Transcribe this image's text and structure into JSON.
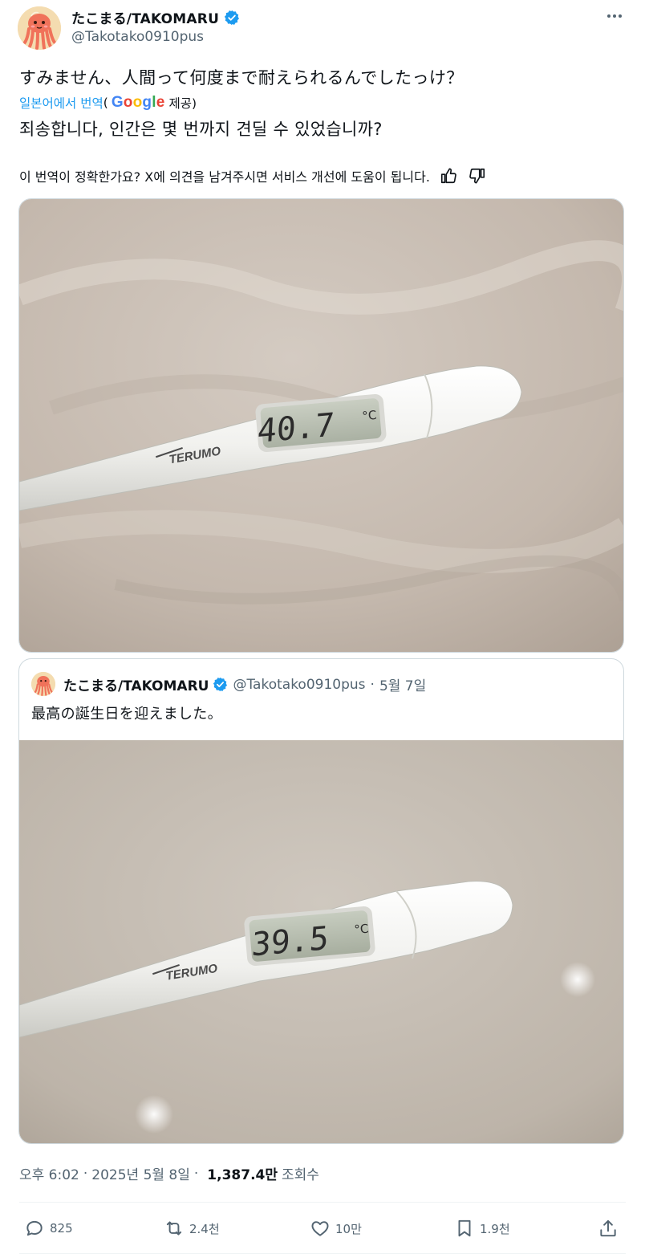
{
  "author": {
    "display_name": "たこまる/TAKOMARU",
    "handle": "@Takotako0910pus",
    "verified": true,
    "avatar_icon": "octopus-avatar-icon"
  },
  "post": {
    "original_text": "すみません、人間って何度まで耐えられるんでしたっけ？",
    "translation_label": "일본어에서 번역",
    "google_text": "Google",
    "provider_suffix": "제공)",
    "translated_text": "죄송합니다, 인간은 몇 번까지 견딜 수 있었습니까?",
    "feedback_text": "이 번역이 정확한가요? X에 의견을 남겨주시면 서비스 개선에 도움이 됩니다.",
    "photo": {
      "brand": "TERUMO",
      "reading": "40.7",
      "unit": "°C"
    }
  },
  "quote": {
    "display_name": "たこまる/TAKOMARU",
    "handle": "@Takotako0910pus",
    "separator": "·",
    "date": "5월 7일",
    "text": "最高の誕生日を迎えました。",
    "photo": {
      "brand": "TERUMO",
      "reading": "39.5",
      "unit": "°C"
    }
  },
  "meta": {
    "time": "오후 6:02",
    "date": "2025년 5월 8일",
    "separator": "·",
    "views_count": "1,387.4만",
    "views_label": "조회수"
  },
  "actions": {
    "replies": "825",
    "reposts": "2.4천",
    "likes": "10만",
    "bookmarks": "1.9천"
  },
  "colors": {
    "accent": "#1d9bf0",
    "secondary_text": "#536471",
    "border": "#cfd9de"
  }
}
